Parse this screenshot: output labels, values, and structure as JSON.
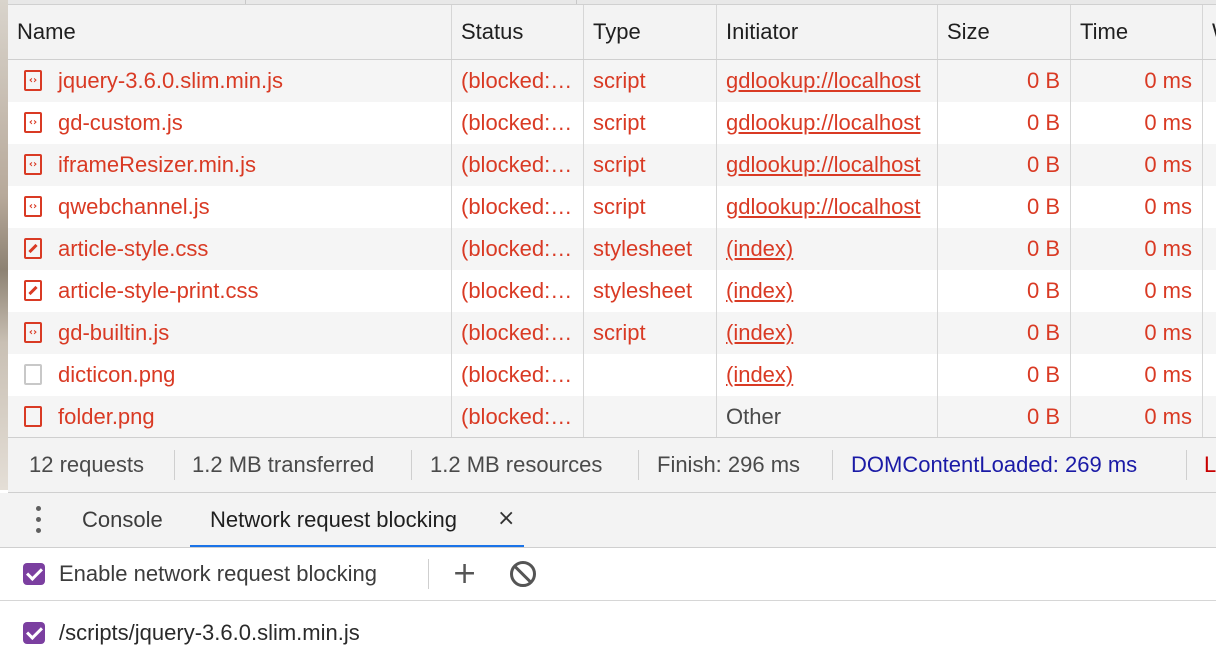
{
  "columns": [
    "Name",
    "Status",
    "Type",
    "Initiator",
    "Size",
    "Time"
  ],
  "requests": [
    {
      "name": "jquery-3.6.0.slim.min.js",
      "icon": "script-icon",
      "status": "(blocked:devtools)",
      "type": "script",
      "initiator": "gdlookup://localhost",
      "size": "0 B",
      "time": "0 ms"
    },
    {
      "name": "gd-custom.js",
      "icon": "script-icon",
      "status": "(blocked:devtools)",
      "type": "script",
      "initiator": "gdlookup://localhost",
      "size": "0 B",
      "time": "0 ms"
    },
    {
      "name": "iframeResizer.min.js",
      "icon": "script-icon",
      "status": "(blocked:devtools)",
      "type": "script",
      "initiator": "gdlookup://localhost",
      "size": "0 B",
      "time": "0 ms"
    },
    {
      "name": "qwebchannel.js",
      "icon": "script-icon",
      "status": "(blocked:devtools)",
      "type": "script",
      "initiator": "gdlookup://localhost",
      "size": "0 B",
      "time": "0 ms"
    },
    {
      "name": "article-style.css",
      "icon": "stylesheet-icon",
      "status": "(blocked:devtools)",
      "type": "stylesheet",
      "initiator": "(index)",
      "size": "0 B",
      "time": "0 ms"
    },
    {
      "name": "article-style-print.css",
      "icon": "stylesheet-icon",
      "status": "(blocked:devtools)",
      "type": "stylesheet",
      "initiator": "(index)",
      "size": "0 B",
      "time": "0 ms"
    },
    {
      "name": "gd-builtin.js",
      "icon": "script-icon",
      "status": "(blocked:devtools)",
      "type": "script",
      "initiator": "(index)",
      "size": "0 B",
      "time": "0 ms"
    },
    {
      "name": "dicticon.png",
      "icon": "image-icon",
      "status": "(blocked:devtools)",
      "type": "",
      "initiator": "(index)",
      "size": "0 B",
      "time": "0 ms"
    },
    {
      "name": "folder.png",
      "icon": "image-icon",
      "status": "(blocked:devtools)",
      "type": "",
      "initiator": "Other",
      "size": "0 B",
      "time": "0 ms"
    }
  ],
  "summary": {
    "requests": "12 requests",
    "transferred": "1.2 MB transferred",
    "resources": "1.2 MB resources",
    "finish": "Finish: 296 ms",
    "dom_content_loaded": "DOMContentLoaded: 269 ms",
    "load": "L"
  },
  "drawer": {
    "tabs": [
      "Console",
      "Network request blocking"
    ],
    "active_tab": "Network request blocking",
    "close_glyph": "×"
  },
  "blocking": {
    "enable_label": "Enable network request blocking",
    "enabled": true,
    "add_glyph": "+",
    "patterns": [
      {
        "pattern": "/scripts/jquery-3.6.0.slim.min.js",
        "enabled": true
      }
    ]
  },
  "colors": {
    "blocked_text": "#d93a24",
    "dcl_blue": "#1a1aa6",
    "load_red": "#c80000",
    "checkbox": "#7b3fa0",
    "tab_underline": "#1a73e8"
  }
}
